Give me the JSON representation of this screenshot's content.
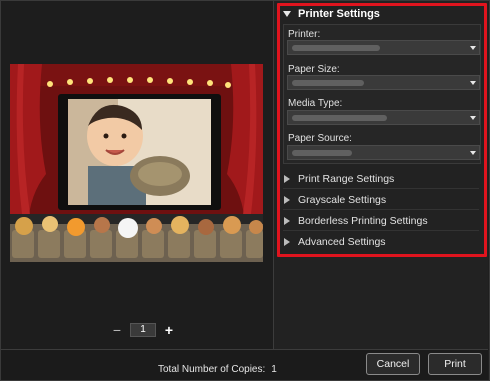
{
  "preview": {
    "page_number": "1",
    "zoom_out_symbol": "−",
    "zoom_in_symbol": "+"
  },
  "settings": {
    "printer_settings": {
      "title": "Printer Settings",
      "fields": [
        {
          "label": "Printer:"
        },
        {
          "label": "Paper Size:"
        },
        {
          "label": "Media Type:"
        },
        {
          "label": "Paper Source:"
        }
      ]
    },
    "collapsed_sections": [
      {
        "label": "Print Range Settings"
      },
      {
        "label": "Grayscale Settings"
      },
      {
        "label": "Borderless Printing Settings"
      },
      {
        "label": "Advanced Settings"
      }
    ],
    "highlight_color": "#e0141e"
  },
  "footer": {
    "copies_label": "Total Number of Copies:",
    "copies_value": "1",
    "cancel_label": "Cancel",
    "print_label": "Print"
  }
}
